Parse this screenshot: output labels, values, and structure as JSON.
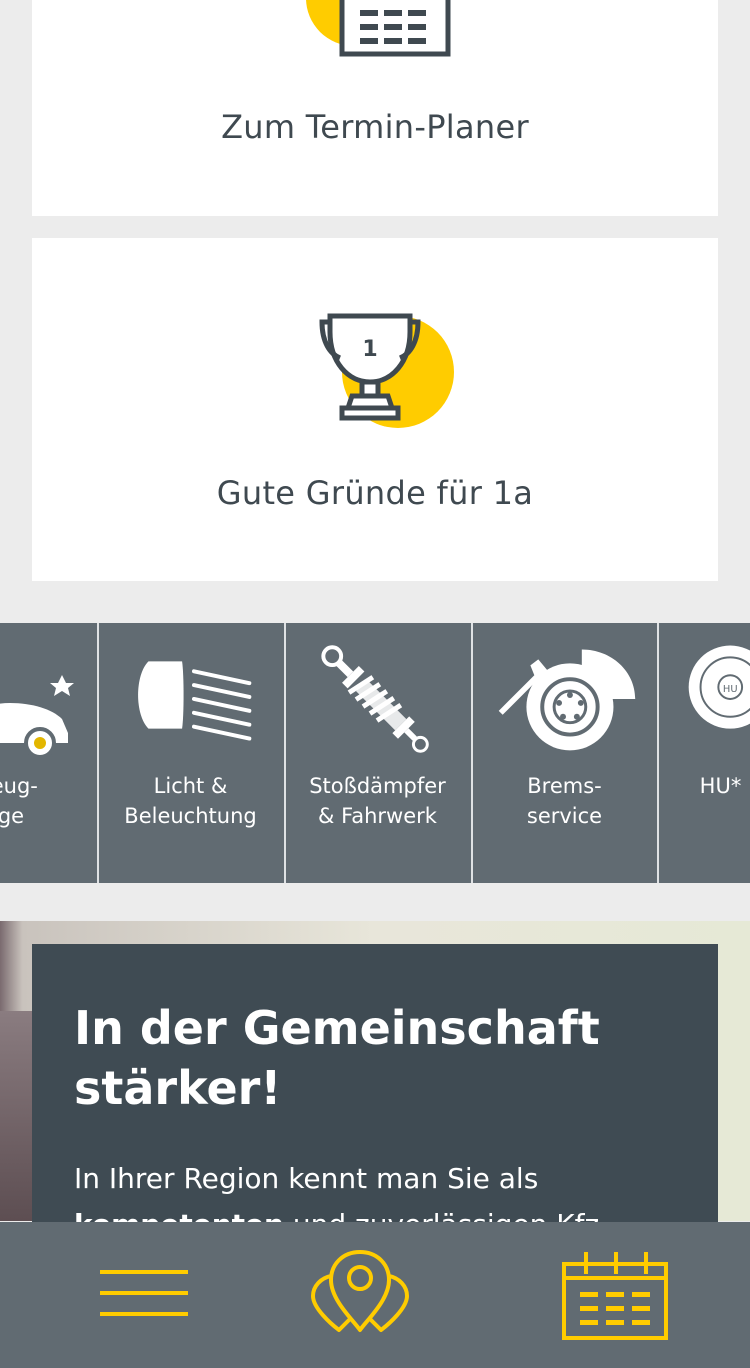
{
  "cards": {
    "termin_label": "Zum Termin-Planer",
    "gruende_label": "Gute Gründe für 1a",
    "trophy_number": "1"
  },
  "services": {
    "items": [
      {
        "label": "rzeug-\nege",
        "icon": "car-care-icon"
      },
      {
        "label": "Licht  &\nBeleuchtung",
        "icon": "headlight-icon"
      },
      {
        "label": "Stoßdämpfer\n& Fahrwerk",
        "icon": "shock-absorber-icon"
      },
      {
        "label": "Brems-\nservice",
        "icon": "brake-disc-icon"
      },
      {
        "label": "HU*",
        "icon": "hu-sticker-icon"
      }
    ]
  },
  "promo": {
    "title": "In der Gemeinschaft stärker!",
    "text_normal": "In Ihrer Region kennt man Sie als",
    "text_bold": "kompetenten",
    "text_rest": " und zuverlässigen Kfz-"
  },
  "bottom_nav": {
    "items": [
      {
        "icon": "menu-icon"
      },
      {
        "icon": "location-pins-icon"
      },
      {
        "icon": "calendar-icon"
      }
    ]
  },
  "colors": {
    "accent": "#ffcc00",
    "tile_bg": "#616b72",
    "dark_panel": "#3f4b53",
    "page_bg": "#ececec"
  }
}
